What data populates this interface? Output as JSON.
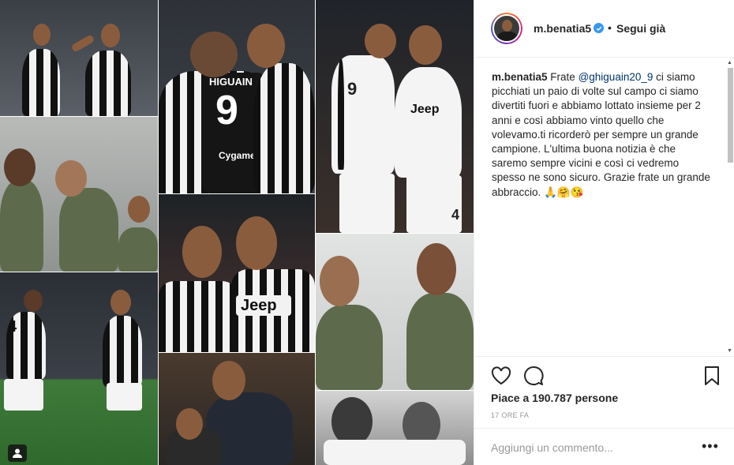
{
  "post": {
    "username": "m.benatia5",
    "follow_label": "Segui già",
    "separator": "•",
    "caption_user": "m.benatia5",
    "caption_start": "Frate",
    "mention": "@ghiguain20_9",
    "caption_body": "ci siamo picchiati un paio di volte sul campo ci siamo divertiti fuori e abbiamo lottato insieme per 2 anni e così abbiamo vinto quello che volevamo.ti ricorderò per sempre un grande campione. L'ultima buona notizia è che saremo sempre vicini e così ci vedremo spesso ne sono sicuro. Grazie frate un grande abbraccio. 🙏🤗😘",
    "likes": "Piace a 190.787 persone",
    "time": "17 ORE FA",
    "comment_placeholder": "Aggiungi un commento...",
    "more": "•••"
  },
  "collage": {
    "shirt_number_9": "9",
    "shirt_number_4": "4",
    "shirt_name": "HIGUAIN",
    "sponsor_jeep": "Jeep",
    "sponsor_cygames": "Cygames"
  },
  "icons": {
    "like": "heart-icon",
    "comment": "comment-icon",
    "save": "bookmark-icon",
    "verified": "verified-badge-icon",
    "carousel": "multiple-photos-icon"
  },
  "colors": {
    "verified_blue": "#3897f0",
    "border": "#efefef",
    "muted": "#999999",
    "link": "#003569"
  }
}
